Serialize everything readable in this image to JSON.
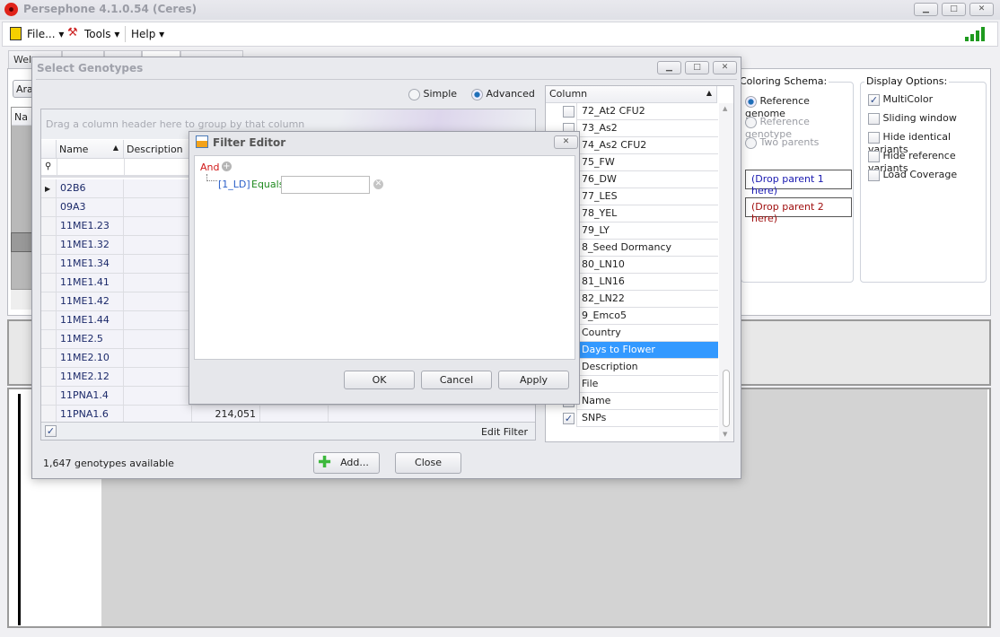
{
  "app": {
    "title": "Persephone 4.1.0.54 (Ceres)",
    "window_buttons": [
      "minimize",
      "maximize",
      "close"
    ]
  },
  "toolbar": {
    "file": "File...",
    "tools": "Tools",
    "help": "Help"
  },
  "tabs": [
    "Wel",
    "",
    "",
    "",
    ""
  ],
  "background": {
    "dropdown_partial": "Ara",
    "grid_header_partial": "Na",
    "coloring": {
      "label": "Coloring Schema:",
      "options": [
        {
          "label": "Reference genome",
          "selected": true,
          "enabled": true
        },
        {
          "label": "Reference genotype",
          "selected": false,
          "enabled": false
        },
        {
          "label": "Two parents",
          "selected": false,
          "enabled": false
        }
      ],
      "drop1": "(Drop parent 1 here)",
      "drop2": "(Drop parent 2 here)"
    },
    "display": {
      "label": "Display Options:",
      "options": [
        {
          "label": "MultiColor",
          "checked": true
        },
        {
          "label": "Sliding window",
          "checked": false
        },
        {
          "label": "Hide identical variants",
          "checked": false
        },
        {
          "label": "Hide reference variants",
          "checked": false
        },
        {
          "label": "Load Coverage",
          "checked": false
        }
      ]
    }
  },
  "select_dialog": {
    "title": "Select Genotypes",
    "mode_simple": "Simple",
    "mode_advanced": "Advanced",
    "mode_selected": "Advanced",
    "group_panel": "Drag a column header here to group by that column",
    "columns": [
      "Name",
      "Description"
    ],
    "rows": [
      {
        "name": "02B6",
        "value": ""
      },
      {
        "name": "09A3",
        "value": ""
      },
      {
        "name": "11ME1.23",
        "value": ""
      },
      {
        "name": "11ME1.32",
        "value": ""
      },
      {
        "name": "11ME1.34",
        "value": ""
      },
      {
        "name": "11ME1.41",
        "value": ""
      },
      {
        "name": "11ME1.42",
        "value": ""
      },
      {
        "name": "11ME1.44",
        "value": ""
      },
      {
        "name": "11ME2.5",
        "value": ""
      },
      {
        "name": "11ME2.10",
        "value": ""
      },
      {
        "name": "11ME2.12",
        "value": ""
      },
      {
        "name": "11PNA1.4",
        "value": ""
      },
      {
        "name": "11PNA1.6",
        "value": "214,051"
      }
    ],
    "edit_filter": "Edit Filter",
    "status": "1,647 genotypes available",
    "add": "Add...",
    "close": "Close",
    "column_chooser": {
      "header": "Column",
      "items": [
        {
          "label": "72_At2 CFU2",
          "checked": false
        },
        {
          "label": "73_As2",
          "checked": false
        },
        {
          "label": "74_As2 CFU2",
          "checked": false
        },
        {
          "label": "75_FW",
          "checked": false
        },
        {
          "label": "76_DW",
          "checked": false
        },
        {
          "label": "77_LES",
          "checked": false
        },
        {
          "label": "78_YEL",
          "checked": false
        },
        {
          "label": "79_LY",
          "checked": false
        },
        {
          "label": "8_Seed Dormancy",
          "checked": false
        },
        {
          "label": "80_LN10",
          "checked": false
        },
        {
          "label": "81_LN16",
          "checked": false
        },
        {
          "label": "82_LN22",
          "checked": false
        },
        {
          "label": "9_Emco5",
          "checked": false
        },
        {
          "label": "Country",
          "checked": false
        },
        {
          "label": "Days to Flower",
          "checked": false,
          "selected": true
        },
        {
          "label": "Description",
          "checked": false
        },
        {
          "label": "File",
          "checked": false
        },
        {
          "label": "Name",
          "checked": true
        },
        {
          "label": "SNPs",
          "checked": true
        }
      ]
    }
  },
  "filter_editor": {
    "title": "Filter Editor",
    "group_op": "And",
    "field": "[1_LD]",
    "operator": "Equals",
    "value": "",
    "ok": "OK",
    "cancel": "Cancel",
    "apply": "Apply"
  }
}
